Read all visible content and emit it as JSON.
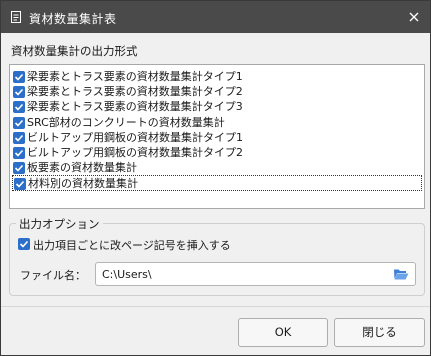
{
  "window": {
    "title": "資材数量集計表",
    "title_icon": "document-icon",
    "close_icon": "close-icon"
  },
  "list_section": {
    "label": "資材数量集計の出力形式",
    "items": [
      {
        "label": "梁要素とトラス要素の資材数量集計タイプ1",
        "checked": true
      },
      {
        "label": "梁要素とトラス要素の資材数量集計タイプ2",
        "checked": true
      },
      {
        "label": "梁要素とトラス要素の資材数量集計タイプ3",
        "checked": true
      },
      {
        "label": "SRC部材のコンクリートの資材数量集計",
        "checked": true
      },
      {
        "label": "ビルトアップ用鋼板の資材数量集計タイプ1",
        "checked": true
      },
      {
        "label": "ビルトアップ用鋼板の資材数量集計タイプ2",
        "checked": true
      },
      {
        "label": "板要素の資材数量集計",
        "checked": true
      },
      {
        "label": "材料別の資材数量集計",
        "checked": true
      }
    ]
  },
  "options": {
    "title": "出力オプション",
    "page_break_label": "出力項目ごとに改ページ記号を挿入する",
    "page_break_checked": true,
    "file_label": "ファイル名：",
    "file_value": "C:\\Users\\",
    "folder_icon": "folder-open-icon"
  },
  "buttons": {
    "ok": "OK",
    "close": "閉じる"
  },
  "colors": {
    "titlebar": "#4a4a4a",
    "checkbox": "#2b6fc9",
    "folder": "#3d7fd6"
  }
}
